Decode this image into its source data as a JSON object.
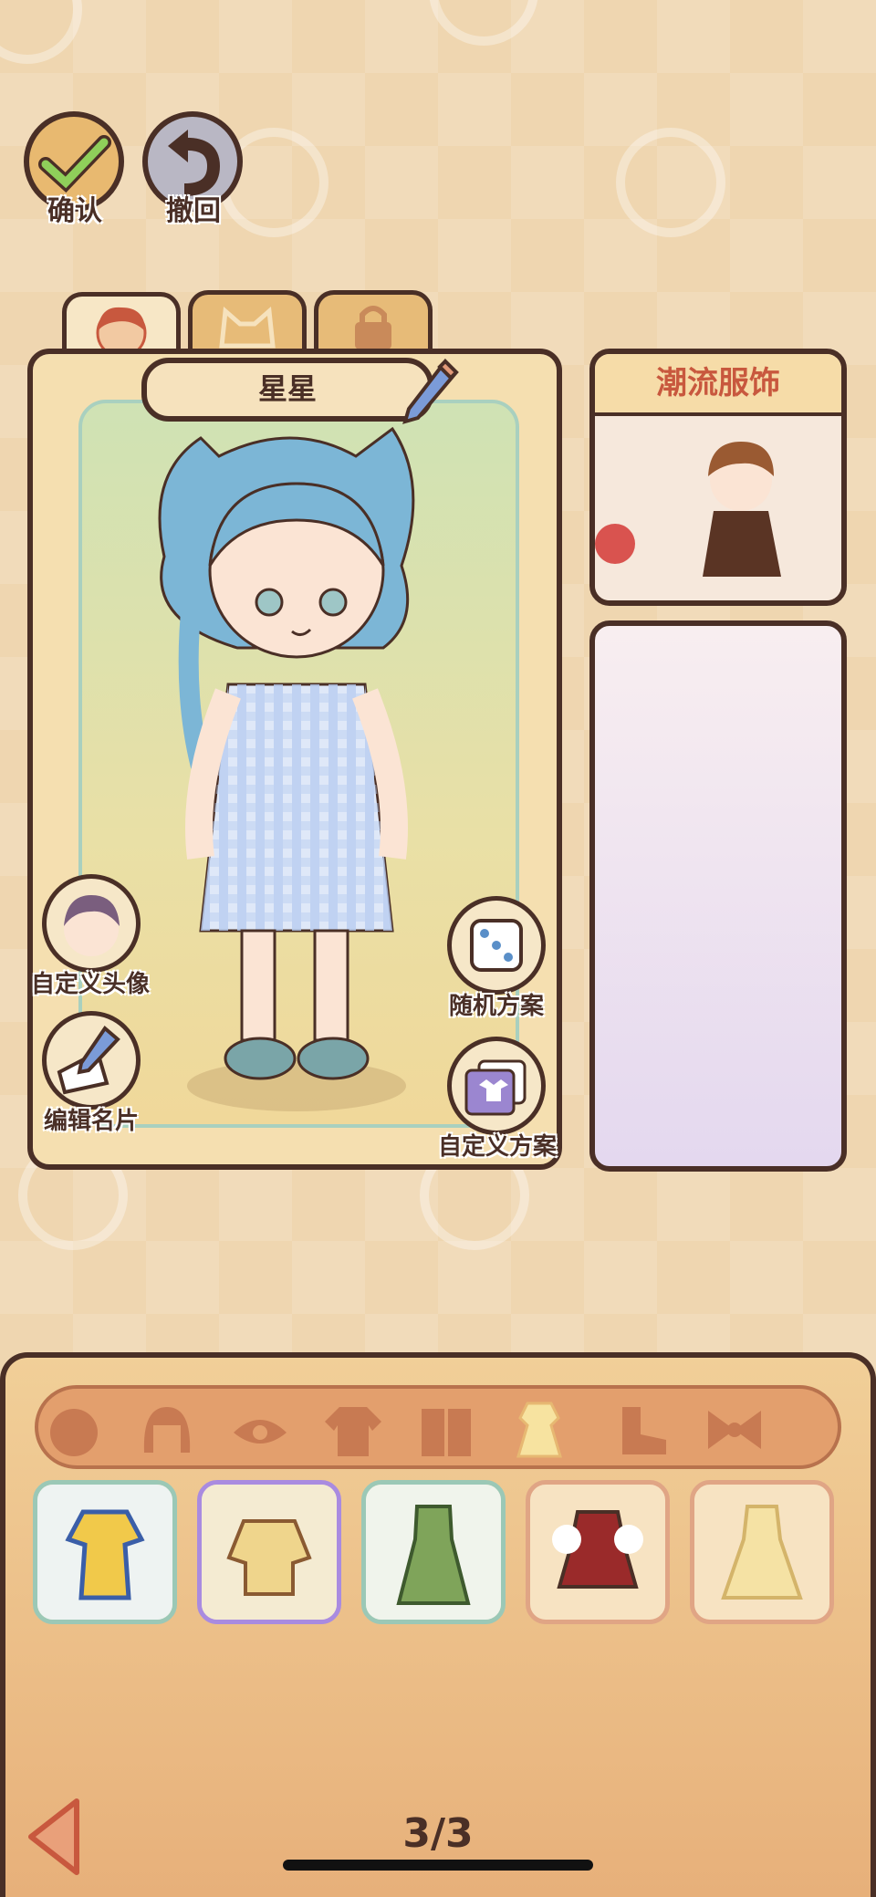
{
  "top_buttons": {
    "confirm_label": "确认",
    "undo_label": "撤回"
  },
  "tabs": [
    {
      "name": "character",
      "icon": "face-icon"
    },
    {
      "name": "pet",
      "icon": "cat-icon"
    },
    {
      "name": "locked",
      "icon": "lock-icon"
    }
  ],
  "character": {
    "name": "星星"
  },
  "left_actions": {
    "avatar_label": "自定义头像",
    "edit_card_label": "编辑名片"
  },
  "right_actions": {
    "random_label": "随机方案",
    "custom_label": "自定义方案"
  },
  "event": {
    "title": "潮流服饰"
  },
  "category_icons": [
    "head-icon",
    "hair-icon",
    "eye-icon",
    "shirt-icon",
    "coat-icon",
    "dress-icon",
    "shoe-icon",
    "bow-icon"
  ],
  "active_category": "dress-icon",
  "items": [
    "blue-yellow-outfit",
    "yellow-brown-outfit",
    "green-dress-outfit",
    "red-pinafore-outfit",
    "gingham-yellow-dress"
  ],
  "pager": {
    "text": "3/3"
  },
  "colors": {
    "outline": "#4a2f26",
    "accent": "#c8583e"
  }
}
